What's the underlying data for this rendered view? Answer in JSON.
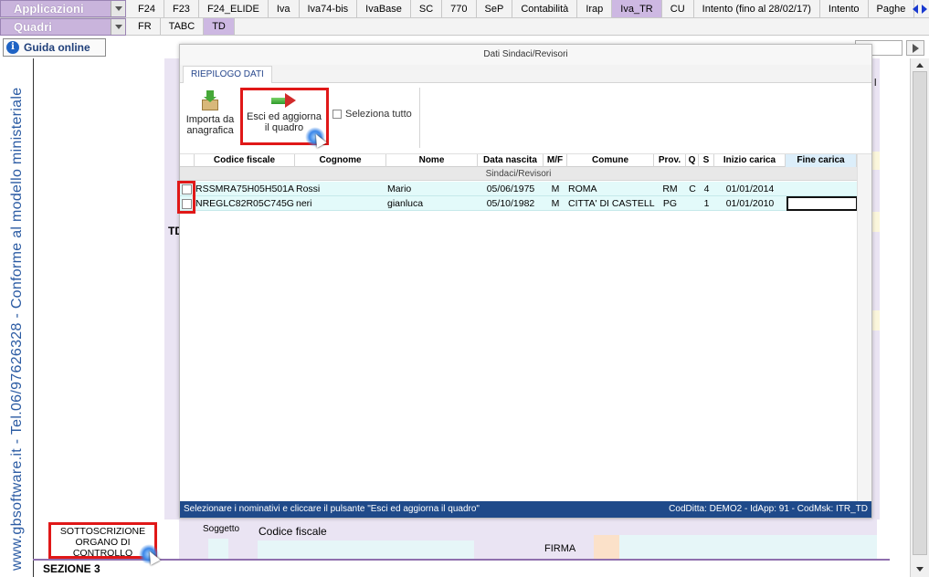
{
  "menubar": {
    "applicazioni_label": "Applicazioni",
    "quadri_label": "Quadri",
    "app_tabs": [
      "F24",
      "F23",
      "F24_ELIDE",
      "Iva",
      "Iva74-bis",
      "IvaBase",
      "SC",
      "770",
      "SeP",
      "Contabilità",
      "Irap",
      "Iva_TR",
      "CU",
      "Intento (fino al 28/02/17)",
      "Intento",
      "Paghe"
    ],
    "app_active": "Iva_TR",
    "quadri_tabs": [
      "FR",
      "TABC",
      "TD"
    ],
    "quadri_active": "TD"
  },
  "guida": {
    "label": "Guida online",
    "icon": "info-icon"
  },
  "document": {
    "vertical_text": "www.gbsoftware.it - Tel.06/97626328 - Conforme al modello ministeriale",
    "td_label": "TD",
    "soggetto_label": "Soggetto",
    "codice_fiscale_label": "Codice fiscale",
    "firma_label": "FIRMA",
    "sottoscrizione_label": "SOTTOSCRIZIONE ORGANO DI CONTROLLO",
    "sezione_label": "SEZIONE 3",
    "right_edge_char": "l"
  },
  "dialog": {
    "title": "Dati Sindaci/Revisori",
    "ribbon_tab": "RIEPILOGO DATI",
    "import_button": "Importa da anagrafica",
    "exit_button": "Esci ed aggiorna il quadro",
    "select_all_label": "Seleziona tutto",
    "columns": [
      "Codice fiscale",
      "Cognome",
      "Nome",
      "Data nascita",
      "M/F",
      "Comune",
      "Prov.",
      "Q",
      "S",
      "Inizio carica",
      "Fine carica"
    ],
    "group_label": "Sindaci/Revisori",
    "rows": [
      {
        "codice_fiscale": "RSSMRA75H05H501A",
        "cognome": "Rossi",
        "nome": "Mario",
        "data_nascita": "05/06/1975",
        "sesso": "M",
        "comune": "ROMA",
        "prov": "RM",
        "q": "C",
        "s": "4",
        "inizio": "01/01/2014",
        "fine": ""
      },
      {
        "codice_fiscale": "NREGLC82R05C745G",
        "cognome": "neri",
        "nome": "gianluca",
        "data_nascita": "05/10/1982",
        "sesso": "M",
        "comune": "CITTA' DI CASTELLO",
        "prov": "PG",
        "q": "",
        "s": "1",
        "inizio": "01/01/2010",
        "fine": ""
      }
    ],
    "status_left": "Selezionare i nominativi e cliccare il pulsante \"Esci ed aggiorna il quadro\"",
    "status_right": "CodDitta: DEMO2 - IdApp: 91 - CodMsk: ITR_TD"
  },
  "colors": {
    "accent_purple": "#cdb8e2",
    "highlight_red": "#e01818",
    "status_blue": "#1f4a8a",
    "row_cyan": "#e3fafa"
  }
}
